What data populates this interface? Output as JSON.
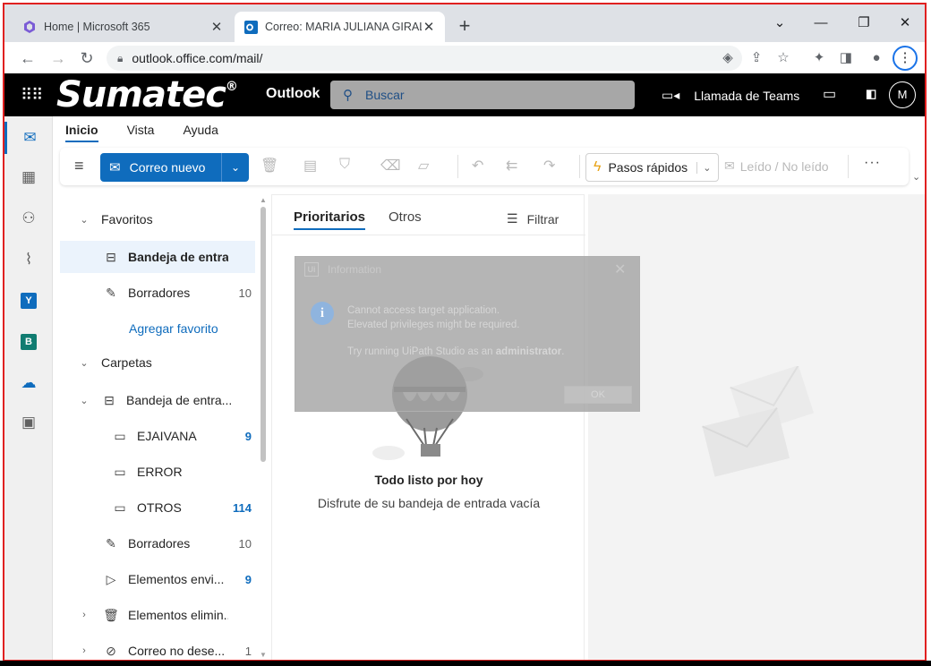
{
  "browser": {
    "tabs": [
      {
        "title": "Home | Microsoft 365",
        "close": "✕"
      },
      {
        "title": "Correo: MARIA JULIANA GIRALDO",
        "close": "✕"
      }
    ],
    "new_tab": "+",
    "url": "outlook.office.com/mail/"
  },
  "header": {
    "logo_text": "Sumatec",
    "logo_mark": "®",
    "app_name": "Outlook",
    "search_placeholder": "Buscar",
    "teams_label": "Llamada de Teams",
    "avatar_initial": "M"
  },
  "ribbon": {
    "tabs": [
      "Inicio",
      "Vista",
      "Ayuda"
    ],
    "new_mail": "Correo nuevo",
    "quick_steps": "Pasos rápidos",
    "read_unread": "Leído / No leído",
    "more": "···"
  },
  "folders": {
    "favorites_header": "Favoritos",
    "favorites": [
      {
        "label": "Bandeja de entra...",
        "count": ""
      },
      {
        "label": "Borradores",
        "count": "10"
      }
    ],
    "add_favorite": "Agregar favorito",
    "folders_header": "Carpetas",
    "inbox": "Bandeja de entra...",
    "subfolders": [
      {
        "label": "EJAIVANA",
        "count": "9"
      },
      {
        "label": "ERROR",
        "count": ""
      },
      {
        "label": "OTROS",
        "count": "114"
      }
    ],
    "others": [
      {
        "label": "Borradores",
        "count": "10"
      },
      {
        "label": "Elementos envi...",
        "count": "9"
      },
      {
        "label": "Elementos elimin...",
        "count": ""
      },
      {
        "label": "Correo no dese...",
        "count": "1"
      }
    ]
  },
  "message_list": {
    "tab_focused": "Prioritarios",
    "tab_other": "Otros",
    "filter": "Filtrar",
    "empty_title": "Todo listo por hoy",
    "empty_subtitle": "Disfrute de su bandeja de entrada vacía"
  },
  "dialog": {
    "title": "Information",
    "line1": "Cannot access target application.",
    "line2": "Elevated privileges might be required.",
    "line3_prefix": "Try running UiPath Studio as an ",
    "line3_bold": "administrator",
    "line3_suffix": ".",
    "ok": "OK"
  },
  "colors": {
    "accent": "#0f6cbd",
    "header_bg": "#000000",
    "frame_border": "#e02020"
  }
}
